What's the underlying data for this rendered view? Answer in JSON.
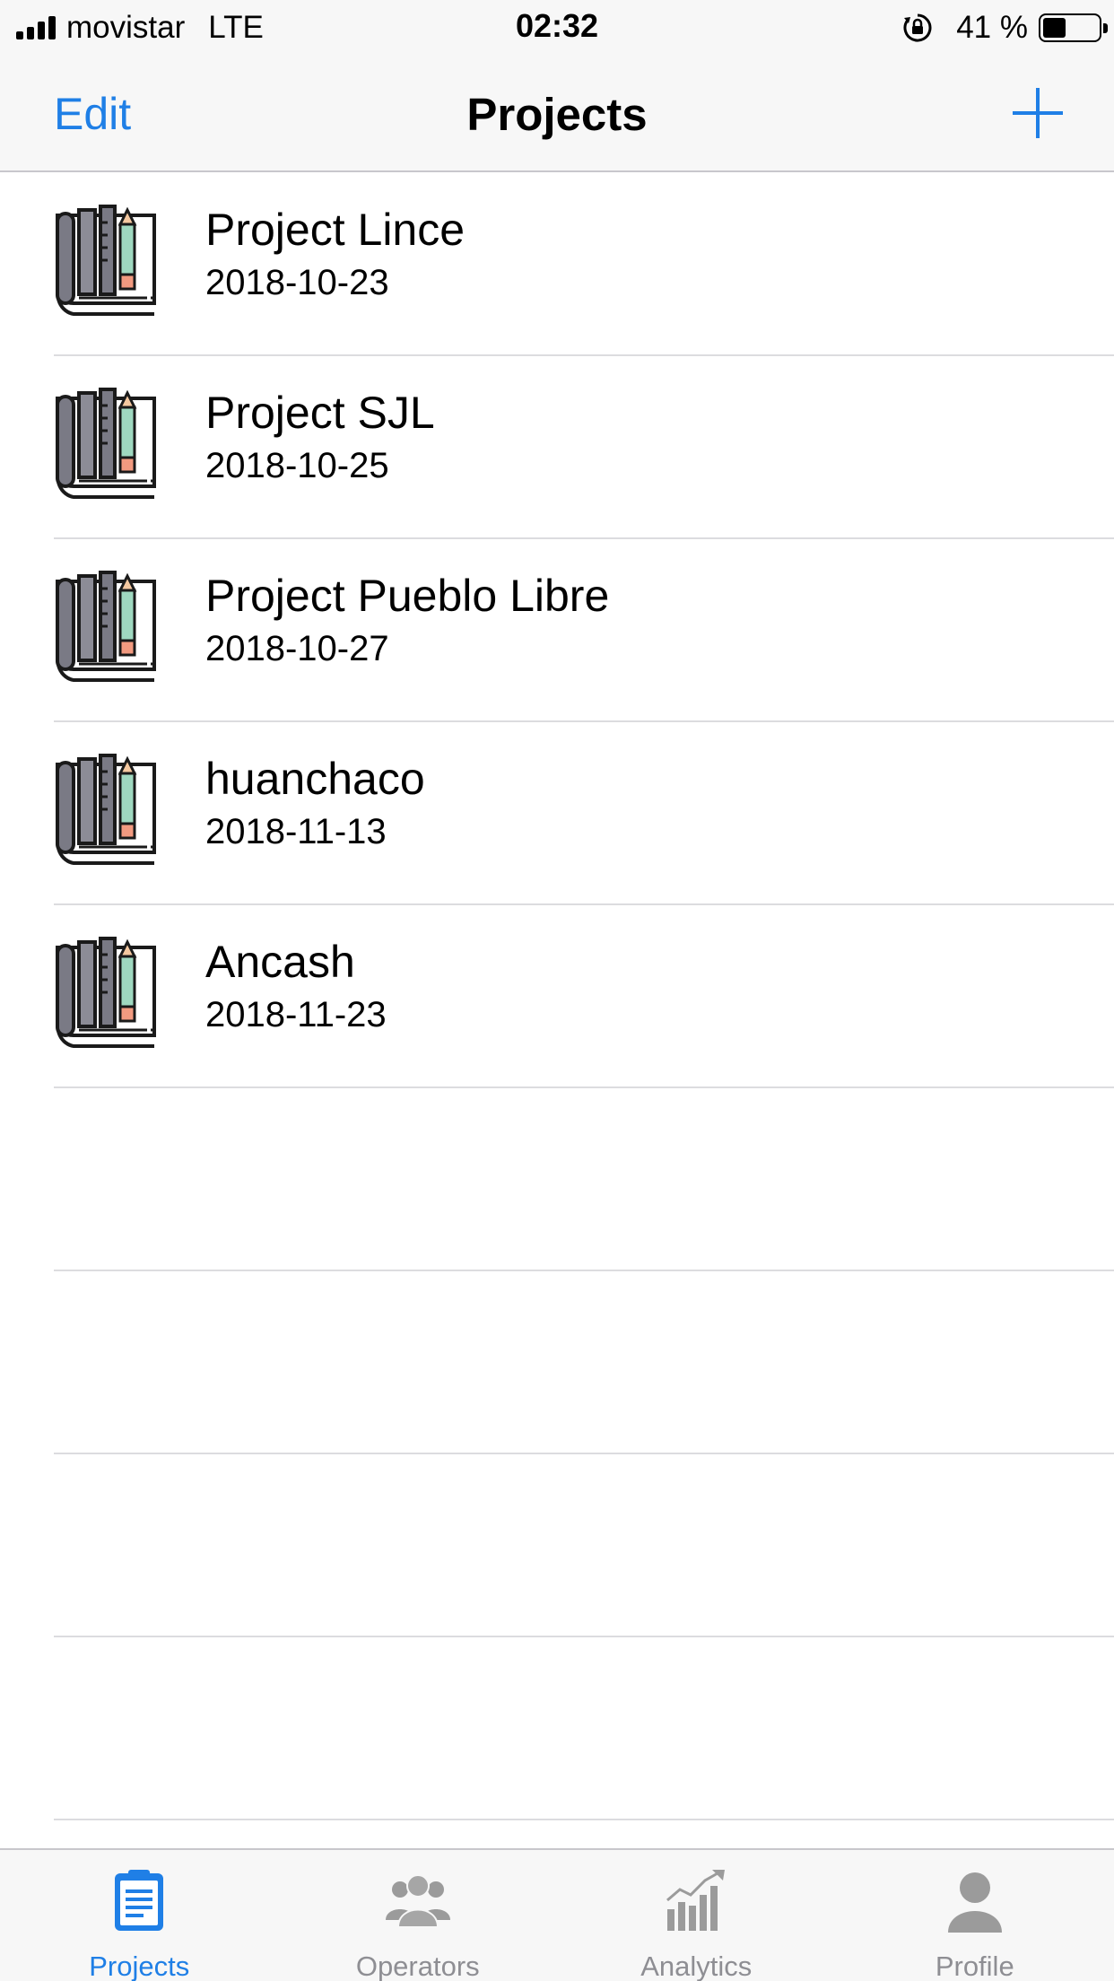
{
  "status_bar": {
    "carrier": "movistar",
    "network": "LTE",
    "time": "02:32",
    "battery_percent": "41 %",
    "battery_level": 0.41
  },
  "nav": {
    "edit_label": "Edit",
    "title": "Projects",
    "add_icon": "plus-icon"
  },
  "projects": [
    {
      "name": "Project Lince",
      "date": "2018-10-23",
      "icon": "project-blueprint-icon"
    },
    {
      "name": "Project SJL",
      "date": "2018-10-25",
      "icon": "project-blueprint-icon"
    },
    {
      "name": "Project Pueblo Libre",
      "date": "2018-10-27",
      "icon": "project-blueprint-icon"
    },
    {
      "name": "huanchaco",
      "date": "2018-11-13",
      "icon": "project-blueprint-icon"
    },
    {
      "name": "Ancash",
      "date": "2018-11-23",
      "icon": "project-blueprint-icon"
    }
  ],
  "tabs": [
    {
      "label": "Projects",
      "icon": "clipboard-icon",
      "active": true
    },
    {
      "label": "Operators",
      "icon": "people-icon",
      "active": false
    },
    {
      "label": "Analytics",
      "icon": "chart-icon",
      "active": false
    },
    {
      "label": "Profile",
      "icon": "person-icon",
      "active": false
    }
  ],
  "colors": {
    "accent": "#1f7fe6",
    "inactive": "#8e8e93",
    "bar_background": "#f7f7f7",
    "separator": "#dcdcdf"
  }
}
